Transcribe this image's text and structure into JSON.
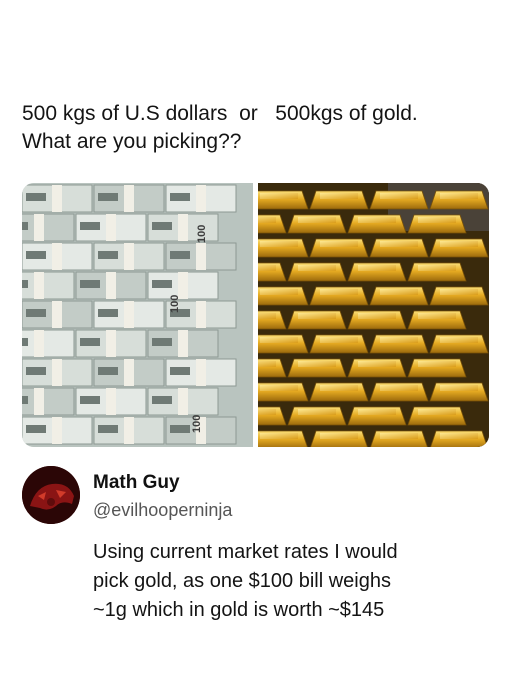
{
  "post": {
    "text_lines": [
      "500 kgs of U.S dollars  or   500kgs of gold.",
      "What are you picking??"
    ]
  },
  "images": {
    "left": {
      "name": "stacks of US dollar bills",
      "strap_label": "100"
    },
    "right": {
      "name": "stacks of gold bars"
    }
  },
  "reply": {
    "name": "Math Guy",
    "handle": "@evilhooperninja",
    "body_lines": [
      "Using current market rates I would",
      "pick gold, as one $100 bill weighs",
      "~1g which in gold is worth ~$145"
    ]
  },
  "colors": {
    "text": "#141414",
    "handle": "#555555",
    "gold": "#e0a91c",
    "cash": "#c8d2cd",
    "avatar": "#6b0f0f"
  }
}
